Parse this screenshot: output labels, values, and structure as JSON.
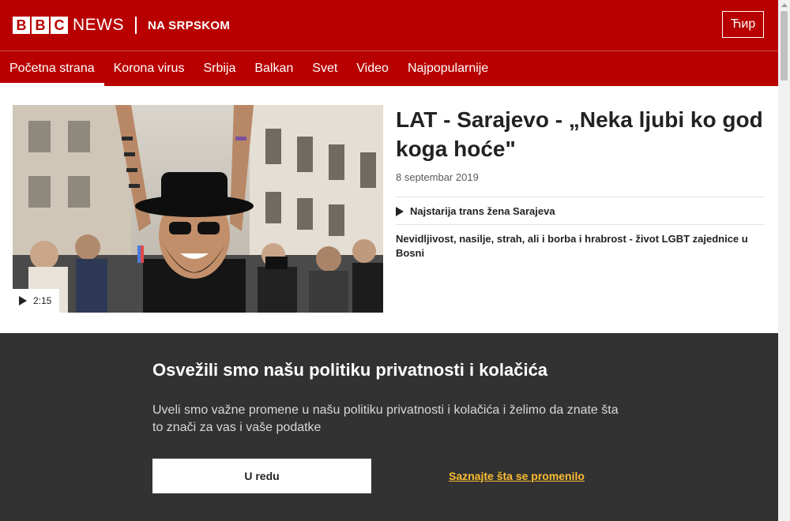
{
  "header": {
    "logo_letters": [
      "B",
      "B",
      "C"
    ],
    "logo_news": "NEWS",
    "edition": "NA SRPSKOM",
    "script_toggle": "Ћир"
  },
  "nav": {
    "items": [
      {
        "label": "Početna strana",
        "active": true
      },
      {
        "label": "Korona virus"
      },
      {
        "label": "Srbija"
      },
      {
        "label": "Balkan"
      },
      {
        "label": "Svet"
      },
      {
        "label": "Video"
      },
      {
        "label": "Najpopularnije"
      }
    ]
  },
  "story": {
    "video_duration": "2:15",
    "headline": "LAT - Sarajevo - „Neka ljubi ko god koga hoće\"",
    "date": "8 septembar 2019",
    "related": [
      {
        "label": "Najstarija trans žena Sarajeva",
        "icon": "play-icon"
      },
      {
        "label": "Nevidljivost, nasilje, strah, ali i borba i hrabrost - život LGBT zajednice u Bosni"
      }
    ]
  },
  "cookie_banner": {
    "title": "Osvežili smo našu politiku privatnosti i kolačića",
    "text": "Uveli smo važne promene u našu politiku privatnosti i kolačića i želimo da znate šta to znači za vas i vaše podatke",
    "accept_label": "U redu",
    "learn_more_label": "Saznajte šta se promenilo"
  },
  "colors": {
    "brand_red": "#b80000",
    "banner_bg": "#323232",
    "link_yellow": "#fcbd31"
  }
}
